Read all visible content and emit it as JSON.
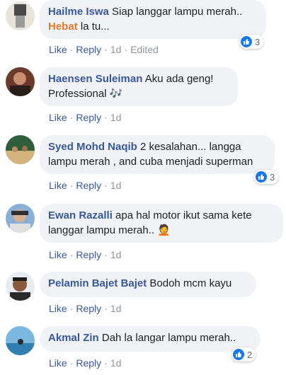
{
  "labels": {
    "like": "Like",
    "reply": "Reply"
  },
  "comments": [
    {
      "name": "Hailme Iswa",
      "text1": " Siap langgar lampu merah..",
      "highlight": "Hebat",
      "text2": " la tu...",
      "time": "1d",
      "edited": "Edited",
      "reactions": "3"
    },
    {
      "name": "Haensen Suleiman",
      "text1": " Aku ada geng!",
      "text2": "Professional ",
      "emoji": "🎶",
      "time": "1d"
    },
    {
      "name": "Syed Mohd Naqib",
      "text1": " 2 kesalahan... langga",
      "text2": "lampu merah , and cuba menjadi superman",
      "time": "1d",
      "reactions": "3"
    },
    {
      "name": "Ewan Razalli",
      "text1": " apa hal motor ikut sama kete",
      "text2": "langgar lampu merah.. ",
      "emoji": "🤦",
      "time": "1d"
    },
    {
      "name": "Pelamin Bajet Bajet",
      "text1": " Bodoh mcm kayu",
      "time": "1d"
    },
    {
      "name": "Akmal Zin",
      "text1": " Dah la langar lampu merah..",
      "time": "1d",
      "reactions": "2"
    }
  ],
  "colors": {
    "link": "#385898",
    "bubble": "#f0f2f5",
    "like_blue": "#1877f2",
    "highlight": "#e07a2e"
  }
}
